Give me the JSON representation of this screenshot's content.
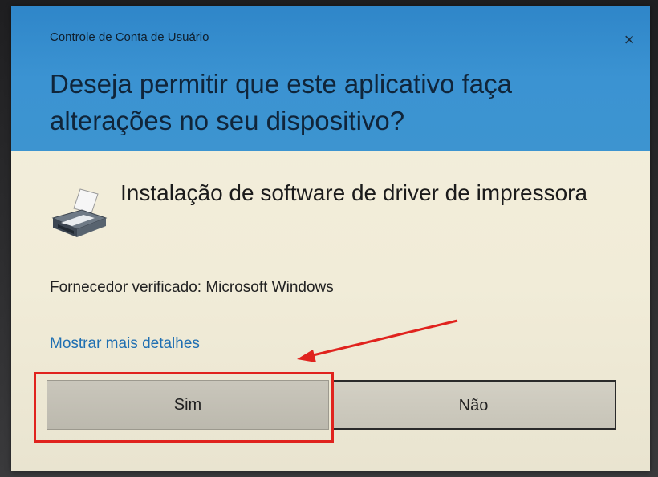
{
  "dialog": {
    "caption": "Controle de Conta de Usuário",
    "close_glyph": "×",
    "title": "Deseja permitir que este aplicativo faça alterações no seu dispositivo?",
    "app_name": "Instalação de software de driver de impressora",
    "publisher": "Fornecedor verificado: Microsoft Windows",
    "details_link": "Mostrar mais detalhes",
    "yes_label": "Sim",
    "no_label": "Não",
    "icon": "printer-icon"
  },
  "colors": {
    "header_blue": "#3b93d2",
    "body_cream": "#f2edda",
    "link_blue": "#1f6fb2",
    "annotation_red": "#e0231e"
  }
}
